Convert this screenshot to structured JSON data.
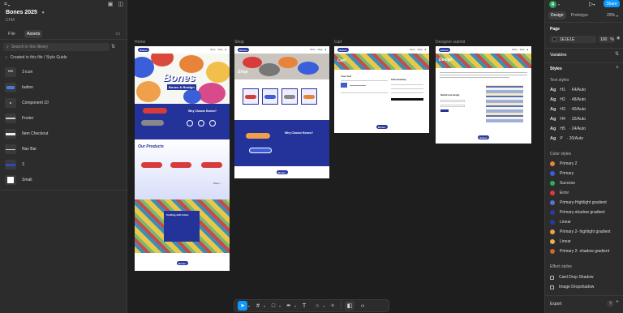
{
  "left_panel": {
    "file_title": "Bones 2025",
    "file_subtitle": "CFM",
    "tabs": [
      "File",
      "Assets"
    ],
    "search_placeholder": "Search in this library",
    "breadcrumb": "Created in this file / Style Guide",
    "components": [
      {
        "label": "3 icon",
        "icon": "dots"
      },
      {
        "label": "button",
        "icon": "button"
      },
      {
        "label": "Component 10",
        "icon": "dot"
      },
      {
        "label": "Footer",
        "icon": "bar"
      },
      {
        "label": "Item Checkout",
        "icon": "bar2"
      },
      {
        "label": "Nav Bar",
        "icon": "bar"
      },
      {
        "label": "3",
        "icon": "blue"
      },
      {
        "label": "Small",
        "icon": "square"
      }
    ]
  },
  "canvas": {
    "frames": [
      {
        "label": "Home",
        "hero_brand": "Bones",
        "hero_tag": "Bones & Realign",
        "why": "Why Choose Bones?",
        "products": "Our Products",
        "crafting": "Crafting with Intent",
        "shop_link": "Shop >"
      },
      {
        "label": "Shop",
        "title": "Shop",
        "why": "Why Choose Bones?"
      },
      {
        "label": "Cart",
        "title": "Cart",
        "your_cart": "Your cart",
        "order_summary": "Order Summary"
      },
      {
        "label": "Designer submit",
        "title": "Design",
        "submit": "Submit your design"
      }
    ],
    "nav_links": [
      "Home",
      "Shop",
      "Cart"
    ],
    "logo_text": "Bones"
  },
  "toolbar": {
    "tools": [
      "move-icon",
      "frame-icon",
      "shape-icon",
      "pen-icon",
      "text-icon",
      "comment-icon",
      "actions-icon"
    ]
  },
  "right_panel": {
    "avatar_letter": "R",
    "share_label": "Share",
    "tabs": [
      "Design",
      "Prototype"
    ],
    "zoom": "20%",
    "page_heading": "Page",
    "page_color": "1E1E1E",
    "page_opacity": "100",
    "page_opacity_unit": "%",
    "variables_label": "Variables",
    "styles_label": "Styles",
    "text_styles_label": "Text styles",
    "text_styles": [
      {
        "tag": "H1",
        "label": "· 64/Auto"
      },
      {
        "tag": "H2",
        "label": "· 48/Auto"
      },
      {
        "tag": "H3",
        "label": "· 40/Auto"
      },
      {
        "tag": "H4",
        "label": "· 32/Auto"
      },
      {
        "tag": "H5",
        "label": "· 24/Auto"
      },
      {
        "tag": "P",
        "label": "· 20/Auto"
      }
    ],
    "color_styles_label": "Color styles",
    "color_styles": [
      {
        "label": "Primary 2",
        "color": "#e8833a"
      },
      {
        "label": "Primary",
        "color": "#3b5fd8"
      },
      {
        "label": "Success",
        "color": "#27b35a"
      },
      {
        "label": "Error",
        "color": "#e03a3a"
      },
      {
        "label": "Primary-Highlight gradient",
        "color": "#5a6fe0"
      },
      {
        "label": "Primary-shadow gradient",
        "color": "#2a3aa0"
      },
      {
        "label": "Linear",
        "color": "#1f3fa0"
      },
      {
        "label": "Primary 2- highlight gradient",
        "color": "#f0a04a"
      },
      {
        "label": "Linear",
        "color": "#f0b04a"
      },
      {
        "label": "Primary 2- shadow gradient",
        "color": "#c86a2a"
      }
    ],
    "effect_styles_label": "Effect styles",
    "effect_styles": [
      "Card Drop Shadow",
      "Image Dropshadow"
    ],
    "export_label": "Export",
    "help_label": "?"
  }
}
